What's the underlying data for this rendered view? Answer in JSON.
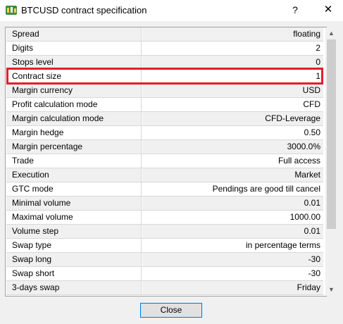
{
  "window": {
    "title": "BTCUSD contract specification",
    "help_label": "?",
    "close_label": "✕"
  },
  "rows": [
    {
      "label": "Spread",
      "value": "floating"
    },
    {
      "label": "Digits",
      "value": "2"
    },
    {
      "label": "Stops level",
      "value": "0"
    },
    {
      "label": "Contract size",
      "value": "1"
    },
    {
      "label": "Margin currency",
      "value": "USD"
    },
    {
      "label": "Profit calculation mode",
      "value": "CFD"
    },
    {
      "label": "Margin calculation mode",
      "value": "CFD-Leverage"
    },
    {
      "label": "Margin hedge",
      "value": "0.50"
    },
    {
      "label": "Margin percentage",
      "value": "3000.0%"
    },
    {
      "label": "Trade",
      "value": "Full access"
    },
    {
      "label": "Execution",
      "value": "Market"
    },
    {
      "label": "GTC mode",
      "value": "Pendings are good till cancel"
    },
    {
      "label": "Minimal volume",
      "value": "0.01"
    },
    {
      "label": "Maximal volume",
      "value": "1000.00"
    },
    {
      "label": "Volume step",
      "value": "0.01"
    },
    {
      "label": "Swap type",
      "value": "in percentage terms"
    },
    {
      "label": "Swap long",
      "value": "-30"
    },
    {
      "label": "Swap short",
      "value": "-30"
    },
    {
      "label": "3-days swap",
      "value": "Friday"
    }
  ],
  "highlighted_row": "Contract size",
  "scrollbar": {
    "up_icon": "▲",
    "down_icon": "▼"
  },
  "footer": {
    "close_button": "Close"
  },
  "colors": {
    "highlight_border": "#e0202a",
    "button_border": "#0078d7"
  }
}
